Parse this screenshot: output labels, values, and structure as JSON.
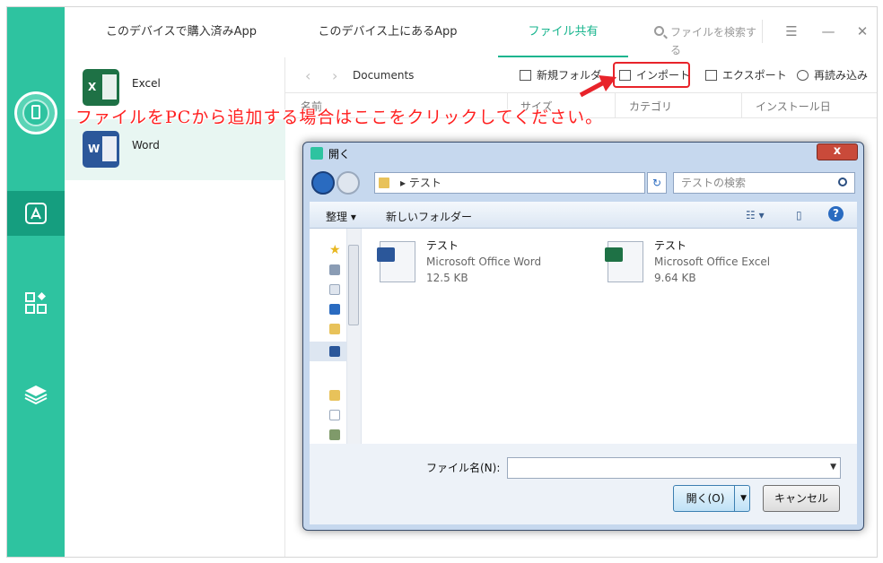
{
  "tabs": [
    {
      "label": "このデバイスで購入済みApp"
    },
    {
      "label": "このデバイス上にあるApp"
    },
    {
      "label": "ファイル共有"
    }
  ],
  "search": {
    "placeholder": "ファイルを検索する"
  },
  "window_controls": {
    "menu": "☰",
    "minimize": "—",
    "close": "✕"
  },
  "apps": [
    {
      "name": "Excel",
      "letter": "X",
      "color": "#1e7145"
    },
    {
      "name": "Word",
      "letter": "W",
      "color": "#2b579a"
    }
  ],
  "toolbar": {
    "back": "‹",
    "forward": "›",
    "breadcrumb": "Documents",
    "new_folder": "新規フォルダ",
    "import": "インポート",
    "export": "エクスポート",
    "reload": "再読み込み"
  },
  "columns": {
    "name": "名前",
    "size": "サイズ",
    "category": "カテゴリ",
    "install_date": "インストール日"
  },
  "annotation": "ファイルをPCから追加する場合はここをクリックしてください。",
  "dialog": {
    "title": "開く",
    "close": "x",
    "path": "テスト",
    "path_separator": "▸",
    "search_placeholder": "テストの検索",
    "organize": "整理",
    "new_folder": "新しいフォルダー",
    "files": [
      {
        "name": "テスト",
        "type": "Microsoft Office Word",
        "size": "12.5 KB"
      },
      {
        "name": "テスト",
        "type": "Microsoft Office Excel",
        "size": "9.64 KB"
      }
    ],
    "filename_label": "ファイル名(N):",
    "filename_value": "",
    "open": "開く(O)",
    "cancel": "キャンセル"
  },
  "colors": {
    "accent": "#2ec3a0",
    "active_tab": "#18b58e",
    "annotation": "#ff2020"
  }
}
